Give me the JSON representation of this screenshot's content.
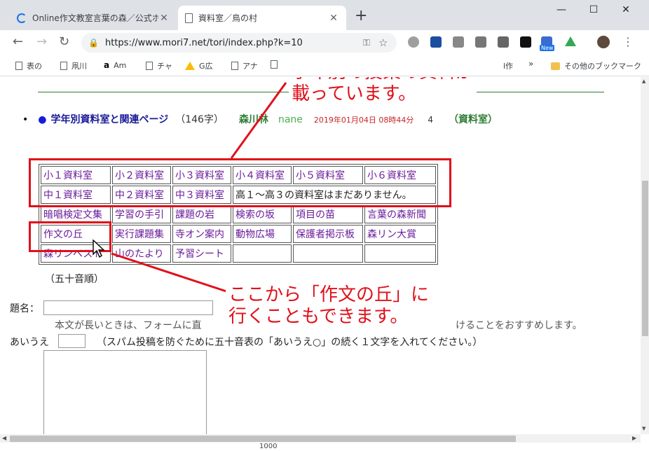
{
  "tabs": [
    {
      "title": "Online作文教室言葉の森／公式ホ",
      "close": "✕"
    },
    {
      "title": "資料室／鳥の村",
      "close": "✕"
    }
  ],
  "new_tab": "+",
  "window": {
    "minimize": "—",
    "maximize": "☐",
    "close": "✕"
  },
  "nav": {
    "back": "←",
    "forward": "→",
    "reload": "↻"
  },
  "address": {
    "url": "https://www.mori7.net/tori/index.php?k=10",
    "lock": "🔒",
    "star": "☆",
    "key": "⚿"
  },
  "extensions": {
    "new_badge": "New",
    "menu": "⋮"
  },
  "bookmarks": [
    {
      "label": "表の",
      "icon": "page"
    },
    {
      "label": "凧川",
      "icon": "page"
    },
    {
      "label": "Am",
      "icon": "amazon"
    },
    {
      "label": "チャ",
      "icon": "page"
    },
    {
      "label": "G広",
      "icon": "google-ads"
    },
    {
      "label": "アナ",
      "icon": "page"
    }
  ],
  "bookmarks_tail": {
    "partial": "l作",
    "chevron": "»",
    "other": "その他のブックマーク"
  },
  "entry": {
    "bullet": "•",
    "dot": "●",
    "title": "学年別資料室と関連ページ",
    "count": "（146字）",
    "author": "森川林",
    "nick": "nane",
    "date": "2019年01月04日 08時44分",
    "num": "4",
    "room": "（資料室）"
  },
  "table": {
    "rows": [
      [
        "小１資料室",
        "小２資料室",
        "小３資料室",
        "小４資料室",
        "小５資料室",
        "小６資料室"
      ],
      [
        "中１資料室",
        "中２資料室",
        "中３資料室",
        "高１～高３の資料室はまだありません。"
      ],
      [
        "暗唱検定文集",
        "学習の手引",
        "課題の岩",
        "検索の坂",
        "項目の苗",
        "言葉の森新聞"
      ],
      [
        "作文の丘",
        "実行課題集",
        "寺オン案内",
        "動物広場",
        "保護者掲示板",
        "森リン大賞"
      ],
      [
        "森リンベスト",
        "山のたより",
        "予習シート",
        "",
        "",
        ""
      ]
    ],
    "footnote": "（五十音順）"
  },
  "form": {
    "title_label": "題名：",
    "long_note_left": "本文が長いときは、フォームに直",
    "long_note_right": "けることをおすすめします。",
    "aiue_label": "あいうえ",
    "spam_note": "（スパム投稿を防ぐために五十音表の「あいうえ○」の続く１文字を入れてください。）"
  },
  "annotations": {
    "top_line1": "学年別の授業の資料が",
    "top_line2": "載っています。",
    "bottom_line1": "ここから「作文の丘」に",
    "bottom_line2": "行くこともできます。"
  },
  "status_partial": "1000",
  "colors": {
    "annotation": "#e0101a",
    "link": "#6a1b9a",
    "title": "#1a1a99",
    "green": "#2e7d32"
  }
}
